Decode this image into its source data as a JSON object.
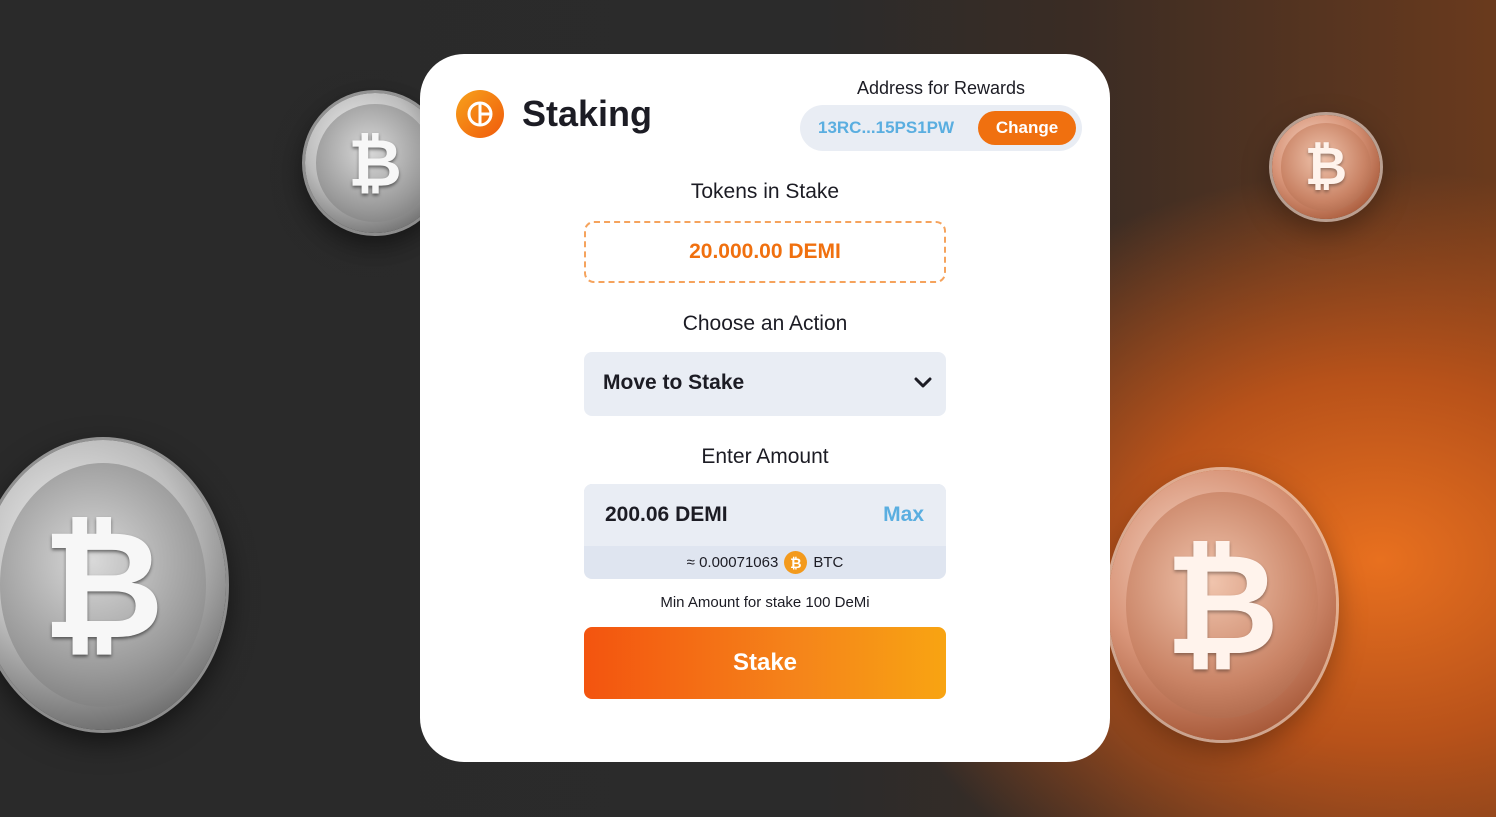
{
  "header": {
    "title": "Staking",
    "logo_icon": "staking-logo-icon"
  },
  "rewards": {
    "label": "Address for Rewards",
    "address": "13RC...15PS1PW",
    "change_label": "Change"
  },
  "stake": {
    "label": "Tokens in Stake",
    "value": "20.000.00 DEMI"
  },
  "action": {
    "label": "Choose an Action",
    "selected": "Move to Stake"
  },
  "amount": {
    "label": "Enter Amount",
    "value": "200.06 DEMI",
    "max_label": "Max",
    "approx_prefix": "≈ 0.00071063",
    "currency": "BTC",
    "min_note": "Min Amount for stake 100 DeMi"
  },
  "submit": {
    "label": "Stake"
  },
  "coins": {
    "symbol": "₿"
  },
  "colors": {
    "accent": "#f0700f",
    "link": "#5aaee0",
    "field_bg": "#e9edf4"
  }
}
